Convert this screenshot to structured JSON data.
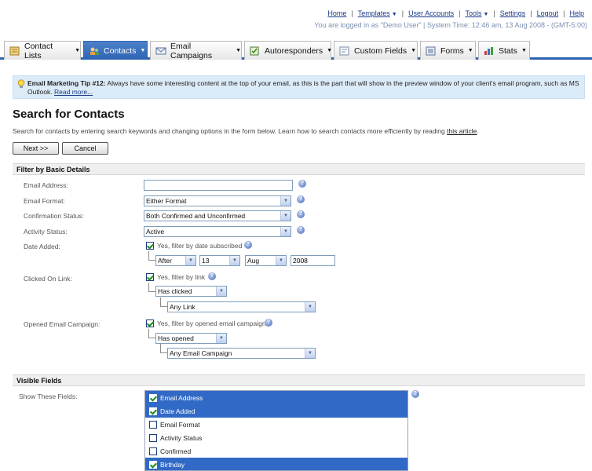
{
  "top_nav": {
    "home": "Home",
    "templates": "Templates",
    "user_accounts": "User Accounts",
    "tools": "Tools",
    "settings": "Settings",
    "logout": "Logout",
    "help": "Help"
  },
  "status_line": "You are logged in as \"Demo User\" | System Time: 12:46 am, 13 Aug 2008 - (GMT-5:00)",
  "tabs": [
    {
      "label": "Contact Lists",
      "icon": "contact-lists-icon"
    },
    {
      "label": "Contacts",
      "icon": "contacts-icon"
    },
    {
      "label": "Email Campaigns",
      "icon": "email-campaigns-icon"
    },
    {
      "label": "Autoresponders",
      "icon": "autoresponders-icon"
    },
    {
      "label": "Custom Fields",
      "icon": "custom-fields-icon"
    },
    {
      "label": "Forms",
      "icon": "forms-icon"
    },
    {
      "label": "Stats",
      "icon": "stats-icon"
    }
  ],
  "active_tab": "Contacts",
  "tip": {
    "title": "Email Marketing Tip #12:",
    "text": " Always have some interesting content at the top of your email, as this is the part that will show in the preview window of your client's email program, such as MS Outlook. ",
    "link": "Read more..."
  },
  "page": {
    "title": "Search for Contacts",
    "intro": "Search for contacts by entering search keywords and changing options in the form below. Learn how to search contacts more efficiently by reading ",
    "intro_link": "this article",
    "intro_end": "."
  },
  "buttons": {
    "next": "Next >>",
    "cancel": "Cancel"
  },
  "filter": {
    "heading": "Filter by Basic Details",
    "email_address_label": "Email Address:",
    "email_address_value": "",
    "email_format_label": "Email Format:",
    "email_format_value": "Either Format",
    "confirmation_label": "Confirmation Status:",
    "confirmation_value": "Both Confirmed and Unconfirmed",
    "activity_label": "Activity Status:",
    "activity_value": "Active",
    "date_added_label": "Date Added:",
    "date_filter_check": "Yes, filter by date subscribed",
    "date_op": "After",
    "date_day": "13",
    "date_month": "Aug",
    "date_year": "2008",
    "clicked_label": "Clicked On Link:",
    "clicked_check": "Yes, filter by link",
    "clicked_op": "Has clicked",
    "clicked_link": "Any Link",
    "opened_label": "Opened Email Campaign:",
    "opened_check": "Yes, filter by opened email campaign",
    "opened_op": "Has opened",
    "opened_campaign": "Any Email Campaign"
  },
  "visible_fields": {
    "heading": "Visible Fields",
    "label": "Show These Fields:",
    "items": [
      {
        "label": "Email Address",
        "checked": true
      },
      {
        "label": "Date Added",
        "checked": true
      },
      {
        "label": "Email Format",
        "checked": false
      },
      {
        "label": "Activity Status",
        "checked": false
      },
      {
        "label": "Confirmed",
        "checked": false
      },
      {
        "label": "Birthday",
        "checked": true
      }
    ]
  },
  "colors": {
    "accent": "#2d64b2",
    "tip_background": "#dcebf8",
    "selected_row": "#3169c6"
  }
}
